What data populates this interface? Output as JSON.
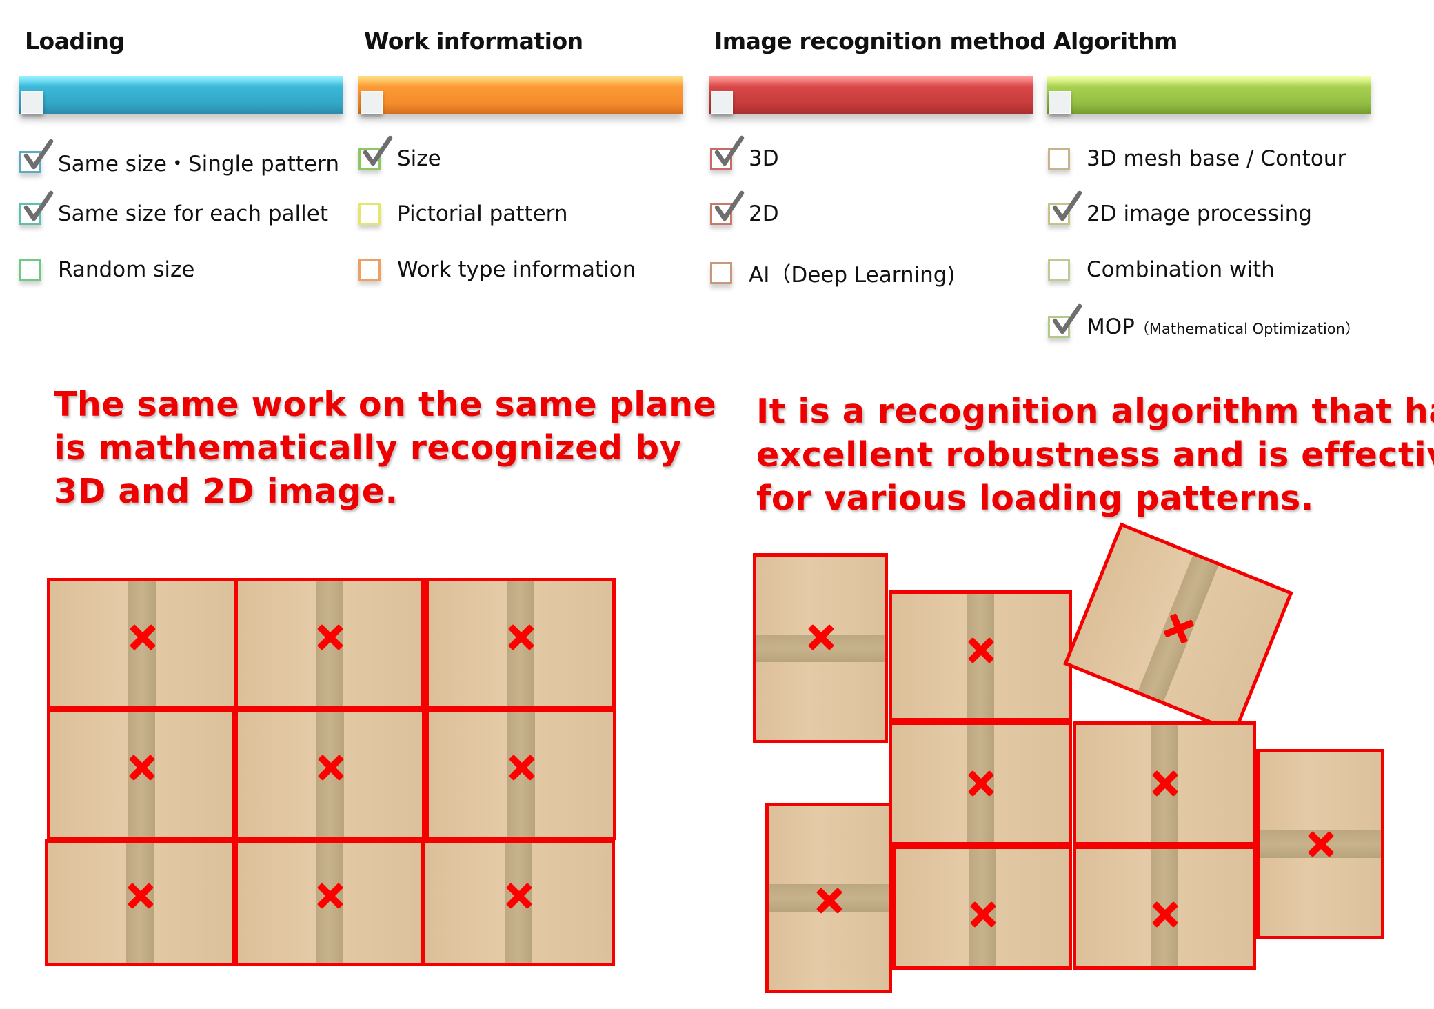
{
  "columns": [
    {
      "title": "Loading",
      "bar_color": "#36afd0",
      "items": [
        {
          "label": "Same size・Single pattern",
          "checked": true,
          "border_color": "#5ea9c6"
        },
        {
          "label": "Same size for each pallet",
          "checked": true,
          "border_color": "#5ec0ac"
        },
        {
          "label": "Random size",
          "checked": false,
          "border_color": "#6ccb7e"
        }
      ]
    },
    {
      "title": "Work information",
      "bar_color": "#f68d2e",
      "items": [
        {
          "label": "Size",
          "checked": true,
          "border_color": "#8cc860"
        },
        {
          "label": "Pictorial pattern",
          "checked": false,
          "border_color": "#e6e66e"
        },
        {
          "label": "Work type information",
          "checked": false,
          "border_color": "#eda066"
        }
      ]
    },
    {
      "title": "Image recognition method",
      "bar_color": "#cc3b3b",
      "items": [
        {
          "label": "3D",
          "checked": true,
          "border_color": "#c86a6a"
        },
        {
          "label": "2D",
          "checked": true,
          "border_color": "#c87a6a"
        },
        {
          "label": "AI（Deep Learning)",
          "checked": false,
          "border_color": "#c89878"
        }
      ]
    },
    {
      "title": "Algorithm",
      "bar_color": "#93bf45",
      "items": [
        {
          "label": "3D mesh base / Contour",
          "checked": false,
          "border_color": "#c8b48a"
        },
        {
          "label": "2D image processing",
          "checked": true,
          "border_color": "#c4c48a"
        },
        {
          "label": "Combination with",
          "checked": false,
          "border_color": "#bccb90"
        },
        {
          "label": "MOP",
          "sublabel": "（Mathematical Optimization）",
          "checked": true,
          "border_color": "#b4c88a"
        }
      ]
    }
  ],
  "captions": {
    "left": [
      "The same work on the same plane",
      "is mathematically recognized by",
      "3D and 2D image."
    ],
    "right": [
      "It is a recognition algorithm that has",
      "excellent robustness and is effective",
      "for various loading patterns."
    ]
  },
  "diagrams": {
    "uniform_grid": {
      "rows": 3,
      "cols": 3,
      "box_count": 9,
      "marker": "red-x",
      "outline_color": "#f40000"
    },
    "mixed_pattern": {
      "box_count": 9,
      "marker": "red-x",
      "outline_color": "#f40000",
      "rotated_boxes": 1
    }
  }
}
